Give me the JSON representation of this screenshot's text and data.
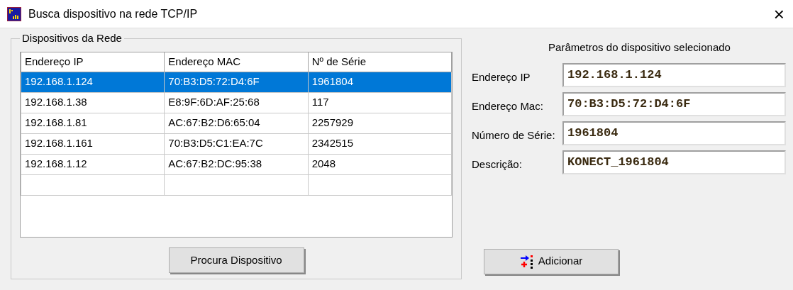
{
  "window": {
    "title": "Busca dispositivo na rede TCP/IP",
    "close": "×"
  },
  "devices_group": {
    "title": "Dispositivos da Rede",
    "columns": [
      "Endereço IP",
      "Endereço MAC",
      "Nº de Série"
    ],
    "rows": [
      {
        "cells": [
          "192.168.1.124",
          "70:B3:D5:72:D4:6F",
          "1961804"
        ],
        "selected": true
      },
      {
        "cells": [
          "192.168.1.38",
          "E8:9F:6D:AF:25:68",
          "117"
        ],
        "selected": false
      },
      {
        "cells": [
          "192.168.1.81",
          "AC:67:B2:D6:65:04",
          "2257929"
        ],
        "selected": false
      },
      {
        "cells": [
          "192.168.1.161",
          "70:B3:D5:C1:EA:7C",
          "2342515"
        ],
        "selected": false
      },
      {
        "cells": [
          "192.168.1.12",
          "AC:67:B2:DC:95:38",
          "2048"
        ],
        "selected": false
      }
    ],
    "button": "Procura Dispositivo"
  },
  "params": {
    "title": "Parâmetros do dispositivo selecionado",
    "fields": [
      {
        "label": "Endereço IP",
        "value": "192.168.1.124"
      },
      {
        "label": "Endereço Mac:",
        "value": "70:B3:D5:72:D4:6F"
      },
      {
        "label": "Número de Série:",
        "value": "1961804"
      },
      {
        "label": "Descrição:",
        "value": "KONECT_1961804"
      }
    ],
    "button": "Adicionar"
  }
}
